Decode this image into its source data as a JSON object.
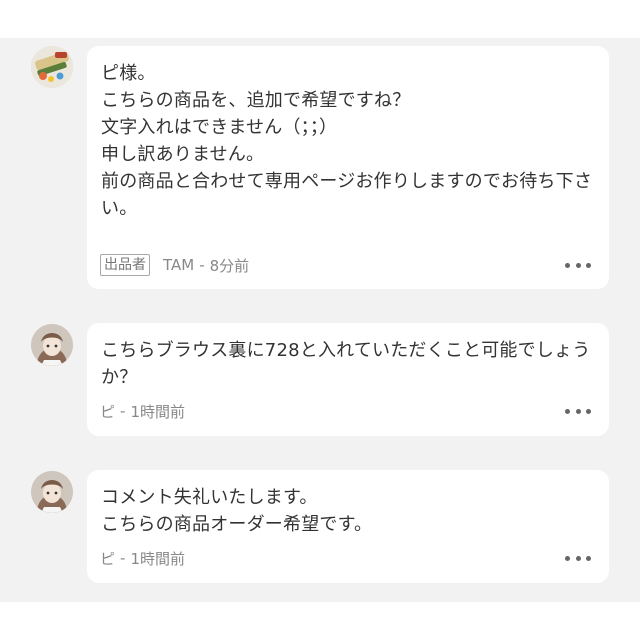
{
  "comments": [
    {
      "text": "ピ様。\nこちらの商品を、追加で希望ですね？\n文字入れはできません（；；）\n申し訳ありません。\n前の商品と合わせて専用ページお作りしますのでお待ち下さい。",
      "badge": "出品者",
      "author": "TAM",
      "separator": "-",
      "time": "8分前",
      "avatar_icon": "product-photo-avatar"
    },
    {
      "text": "こちらブラウス裏に728と入れていただくこと可能でしょうか？",
      "author": "ピ",
      "separator": "-",
      "time": "1時間前",
      "avatar_icon": "illustrated-girl-avatar"
    },
    {
      "text": "コメント失礼いたします。\nこちらの商品オーダー希望です。",
      "author": "ピ",
      "separator": "-",
      "time": "1時間前",
      "avatar_icon": "illustrated-girl-avatar"
    }
  ],
  "colors": {
    "background": "#f2f2f3",
    "bubble": "#ffffff",
    "text": "#333333",
    "meta": "#888888"
  }
}
